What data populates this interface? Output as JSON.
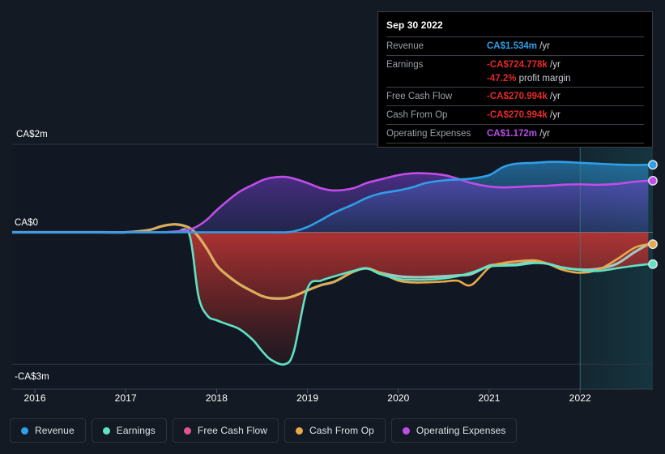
{
  "background_color": "#141a23",
  "tooltip": {
    "date": "Sep 30 2022",
    "rows": [
      {
        "label": "Revenue",
        "value": "CA$1.534m",
        "unit": "/yr",
        "color": "#2e9fe8"
      },
      {
        "label": "Earnings",
        "value": "-CA$724.778k",
        "unit": "/yr",
        "color": "#e52a2a"
      },
      {
        "label": "Free Cash Flow",
        "value": "-CA$270.994k",
        "unit": "/yr",
        "color": "#e52a2a"
      },
      {
        "label": "Cash From Op",
        "value": "-CA$270.994k",
        "unit": "/yr",
        "color": "#e52a2a"
      },
      {
        "label": "Operating Expenses",
        "value": "CA$1.172m",
        "unit": "/yr",
        "color": "#b84de8"
      }
    ],
    "profit_margin_value": "-47.2%",
    "profit_margin_text": "profit margin",
    "profit_margin_color": "#e52a2a"
  },
  "legend": {
    "items": [
      {
        "label": "Revenue",
        "color": "#2e9fe8"
      },
      {
        "label": "Earnings",
        "color": "#5fe3c4"
      },
      {
        "label": "Free Cash Flow",
        "color": "#e0548f"
      },
      {
        "label": "Cash From Op",
        "color": "#e8a94a"
      },
      {
        "label": "Operating Expenses",
        "color": "#c04de8"
      }
    ]
  },
  "chart_data": {
    "type": "area",
    "title": "",
    "xlabel": "",
    "ylabel": "",
    "currency": "CA$",
    "grid": true,
    "legend_position": "bottom",
    "x_ticks": [
      "2016",
      "2017",
      "2018",
      "2019",
      "2020",
      "2021",
      "2022"
    ],
    "x_tick_values": [
      2016,
      2017,
      2018,
      2019,
      2020,
      2021,
      2022
    ],
    "xlim": [
      2015.75,
      2022.8
    ],
    "y_ticks": [
      "CA$2m",
      "CA$0",
      "-CA$3m"
    ],
    "y_tick_values": [
      2000000,
      0,
      -3000000
    ],
    "ylim": [
      -3300000,
      2200000
    ],
    "forecast_start": 2022.0,
    "units": "CA$ (millions)",
    "x": [
      2015.75,
      2016.0,
      2016.25,
      2016.5,
      2016.75,
      2017.0,
      2017.25,
      2017.4,
      2017.55,
      2017.7,
      2017.8,
      2017.9,
      2018.0,
      2018.1,
      2018.25,
      2018.4,
      2018.5,
      2018.6,
      2018.75,
      2018.85,
      2019.0,
      2019.15,
      2019.3,
      2019.5,
      2019.65,
      2019.8,
      2020.0,
      2020.15,
      2020.3,
      2020.5,
      2020.65,
      2020.8,
      2021.0,
      2021.15,
      2021.3,
      2021.5,
      2021.65,
      2021.8,
      2022.0,
      2022.2,
      2022.4,
      2022.6,
      2022.75
    ],
    "series": [
      {
        "name": "Revenue",
        "color": "#2e9fe8",
        "values": [
          0,
          0,
          0,
          0,
          0,
          0,
          0,
          0,
          0,
          0,
          0,
          0,
          0,
          0,
          0,
          0,
          0,
          0,
          0,
          0.02,
          0.12,
          0.28,
          0.45,
          0.63,
          0.78,
          0.88,
          0.95,
          1.02,
          1.12,
          1.18,
          1.2,
          1.22,
          1.3,
          1.48,
          1.56,
          1.58,
          1.6,
          1.6,
          1.58,
          1.56,
          1.54,
          1.53,
          1.534
        ],
        "end_value": 1.534
      },
      {
        "name": "Earnings",
        "color": "#5fe3c4",
        "values": [
          0,
          0,
          0,
          0,
          0,
          0,
          0,
          0,
          0,
          -0.05,
          -1.45,
          -1.9,
          -2.0,
          -2.08,
          -2.2,
          -2.45,
          -2.7,
          -2.9,
          -3.0,
          -2.7,
          -1.28,
          -1.1,
          -1.0,
          -0.88,
          -0.82,
          -0.95,
          -1.06,
          -1.08,
          -1.08,
          -1.05,
          -1.0,
          -0.92,
          -0.78,
          -0.76,
          -0.75,
          -0.7,
          -0.72,
          -0.8,
          -0.86,
          -0.88,
          -0.82,
          -0.76,
          -0.725
        ],
        "end_value": -0.7248
      },
      {
        "name": "Free Cash Flow",
        "color": "#9fc8c0",
        "values": [
          0,
          0,
          0,
          0,
          0,
          0,
          0.05,
          0.14,
          0.18,
          0.1,
          -0.1,
          -0.4,
          -0.75,
          -0.95,
          -1.18,
          -1.35,
          -1.45,
          -1.5,
          -1.5,
          -1.45,
          -1.32,
          -1.2,
          -1.12,
          -0.9,
          -0.82,
          -0.92,
          -1.0,
          -1.02,
          -1.02,
          -1.0,
          -0.98,
          -0.95,
          -0.76,
          -0.74,
          -0.73,
          -0.66,
          -0.72,
          -0.8,
          -0.85,
          -0.83,
          -0.72,
          -0.45,
          -0.271
        ],
        "end_value": -0.271
      },
      {
        "name": "Cash From Op",
        "color": "#e8a94a",
        "values": [
          0,
          0,
          0,
          0,
          0,
          0,
          0.05,
          0.14,
          0.18,
          0.1,
          -0.1,
          -0.4,
          -0.75,
          -0.95,
          -1.18,
          -1.35,
          -1.45,
          -1.5,
          -1.5,
          -1.45,
          -1.32,
          -1.2,
          -1.12,
          -0.9,
          -0.82,
          -0.92,
          -1.1,
          -1.14,
          -1.14,
          -1.12,
          -1.1,
          -1.2,
          -0.8,
          -0.7,
          -0.66,
          -0.64,
          -0.72,
          -0.85,
          -0.92,
          -0.85,
          -0.62,
          -0.35,
          -0.271
        ],
        "end_value": -0.271
      },
      {
        "name": "Operating Expenses",
        "color": "#c04de8",
        "values": [
          0,
          0,
          0,
          0,
          0,
          0,
          0,
          0,
          0.02,
          0.06,
          0.15,
          0.3,
          0.5,
          0.68,
          0.92,
          1.08,
          1.18,
          1.24,
          1.26,
          1.22,
          1.12,
          1.0,
          0.95,
          1.0,
          1.12,
          1.2,
          1.3,
          1.34,
          1.34,
          1.3,
          1.22,
          1.12,
          1.04,
          1.02,
          1.03,
          1.05,
          1.06,
          1.08,
          1.09,
          1.08,
          1.1,
          1.15,
          1.172
        ],
        "end_value": 1.172
      }
    ]
  }
}
